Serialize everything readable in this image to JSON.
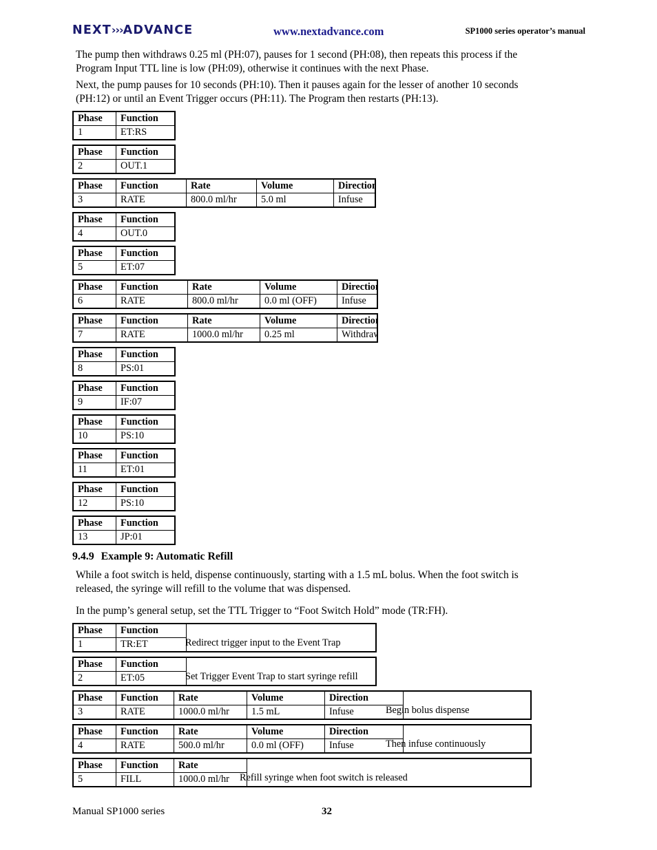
{
  "header": {
    "logo_prefix": "NEXT",
    "logo_chevrons": "›››",
    "logo_suffix": "ADVANCE",
    "url": "www.nextadvance.com",
    "manual_label": "SP1000 series operator’s manual",
    "brand_color": "#1a1a8c"
  },
  "paragraphs": {
    "p1": "The pump then withdraws 0.25 ml (PH:07), pauses for 1 second (PH:08), then repeats this process if the Program Input TTL line is low (PH:09), otherwise it continues with the next Phase.",
    "p2": "Next, the pump pauses for 10 seconds (PH:10).  Then it pauses again for the lesser of another 10 seconds (PH:12) or until an Event Trigger occurs (PH:11).  The Program then restarts (PH:13).",
    "p3": "While a foot switch is held, dispense continuously, starting with a 1.5 mL bolus.  When the foot switch is released, the syringe will refill to the volume that was dispensed.",
    "p4": "In the pump’s general setup, set the TTL Trigger to “Foot Switch Hold” mode (TR:FH)."
  },
  "section": {
    "number": "9.4.9",
    "title": "Example 9:  Automatic Refill"
  },
  "headers": {
    "phase": "Phase",
    "function": "Function",
    "rate": "Rate",
    "volume": "Volume",
    "direction": "Direction"
  },
  "example8_tables": [
    {
      "phase": "1",
      "function": "ET:RS"
    },
    {
      "phase": "2",
      "function": "OUT.1"
    },
    {
      "phase": "3",
      "function": "RATE",
      "rate": "800.0 ml/hr",
      "volume": "5.0 ml",
      "direction": "Infuse"
    },
    {
      "phase": "4",
      "function": "OUT.0"
    },
    {
      "phase": "5",
      "function": "ET:07"
    },
    {
      "phase": "6",
      "function": "RATE",
      "rate": "800.0 ml/hr",
      "volume": "0.0 ml (OFF)",
      "direction": "Infuse"
    },
    {
      "phase": "7",
      "function": "RATE",
      "rate": "1000.0 ml/hr",
      "volume": "0.25 ml",
      "direction": "Withdraw"
    },
    {
      "phase": "8",
      "function": "PS:01"
    },
    {
      "phase": "9",
      "function": "IF:07"
    },
    {
      "phase": "10",
      "function": "PS:10"
    },
    {
      "phase": "11",
      "function": "ET:01"
    },
    {
      "phase": "12",
      "function": "PS:10"
    },
    {
      "phase": "13",
      "function": "JP:01"
    }
  ],
  "example9_tables": [
    {
      "phase": "1",
      "function": "TR:ET",
      "note": "Redirect trigger input to the Event Trap"
    },
    {
      "phase": "2",
      "function": "ET:05",
      "note": "Set Trigger Event Trap to start syringe refill"
    },
    {
      "phase": "3",
      "function": "RATE",
      "rate": "1000.0 ml/hr",
      "volume": "1.5 mL",
      "direction": "Infuse",
      "note": "Begin bolus dispense"
    },
    {
      "phase": "4",
      "function": "RATE",
      "rate": "500.0 ml/hr",
      "volume": "0.0 ml (OFF)",
      "direction": "Infuse",
      "note": "Then infuse continuously"
    },
    {
      "phase": "5",
      "function": "FILL",
      "rate": "1000.0 ml/hr",
      "note": "Refill syringe when foot switch is released"
    }
  ],
  "footer": {
    "left": "Manual SP1000 series",
    "page": "32"
  }
}
